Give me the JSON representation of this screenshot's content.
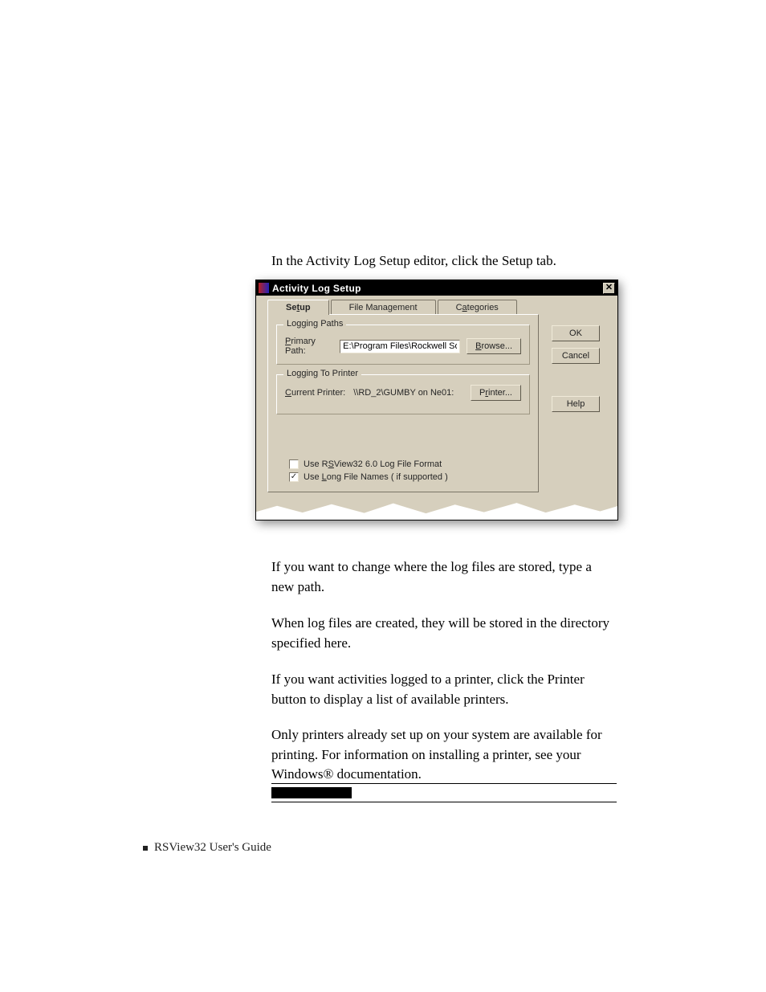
{
  "intro_text": "In the Activity Log Setup editor, click the Setup tab.",
  "paragraphs": {
    "p1": "If you want to change where the log files are stored, type a new path.",
    "p2": "When log files are created, they will be stored in the directory specified here.",
    "p3": "If you want activities logged to a printer, click the Printer button to display a list of available printers.",
    "p4": "Only printers already set up on your system are available for printing. For information on installing a printer, see your Windows® documentation."
  },
  "footer": "RSView32  User's Guide",
  "dialog": {
    "title": "Activity Log Setup",
    "close_glyph": "✕",
    "tabs": {
      "setup": "Setup",
      "file_mgmt": "File Management",
      "categories": "Categories"
    },
    "logging_paths": {
      "legend": "Logging Paths",
      "primary_label": "Primary Path:",
      "primary_value": "E:\\Program Files\\Rockwell Softw",
      "browse_label": "Browse..."
    },
    "logging_printer": {
      "legend": "Logging To Printer",
      "current_label": "Current Printer:",
      "current_value": "\\\\RD_2\\GUMBY on Ne01:",
      "printer_label": "Printer..."
    },
    "checks": {
      "chk1_label": "Use RSView32 6.0 Log File Format",
      "chk1_checked": false,
      "chk2_label": "Use Long File Names ( if supported )",
      "chk2_checked": true,
      "check_glyph": "✓"
    },
    "side": {
      "ok": "OK",
      "cancel": "Cancel",
      "help": "Help"
    }
  }
}
